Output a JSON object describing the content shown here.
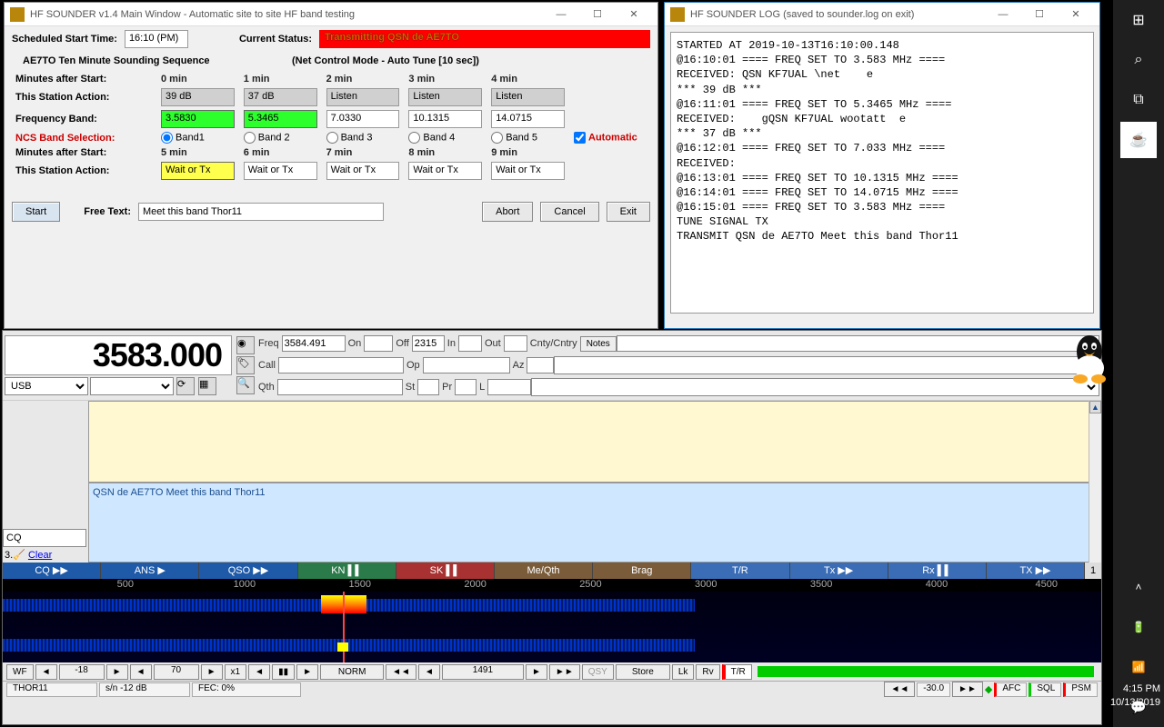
{
  "main": {
    "title": "HF SOUNDER v1.4 Main Window - Automatic site to site HF band testing",
    "sched_lbl": "Scheduled Start Time:",
    "sched_val": "16:10 (PM)",
    "status_lbl": "Current Status:",
    "status_val": "Transmitting QSN de AE7TO",
    "seq_title": "AE7TO  Ten Minute Sounding Sequence",
    "mode_txt": "(Net Control Mode - Auto Tune [10 sec])",
    "min_after": "Minutes after Start:",
    "station_act": "This Station Action:",
    "freq_band": "Frequency Band:",
    "ncs_sel": "NCS Band Selection:",
    "cols1": [
      "0 min",
      "1 min",
      "2 min",
      "3 min",
      "4 min"
    ],
    "acts1": [
      "39 dB",
      "37 dB",
      "Listen",
      "Listen",
      "Listen"
    ],
    "freqs": [
      "3.5830",
      "5.3465",
      "7.0330",
      "10.1315",
      "14.0715"
    ],
    "bands": [
      "Band1",
      "Band 2",
      "Band 3",
      "Band 4",
      "Band 5"
    ],
    "auto": "Automatic",
    "cols2": [
      "5 min",
      "6 min",
      "7 min",
      "8 min",
      "9 min"
    ],
    "acts2": [
      "Wait or Tx",
      "Wait or Tx",
      "Wait or Tx",
      "Wait or Tx",
      "Wait or Tx"
    ],
    "start": "Start",
    "abort": "Abort",
    "cancel": "Cancel",
    "exit": "Exit",
    "freetext_lbl": "Free Text:",
    "freetext_val": "Meet this band Thor11"
  },
  "log": {
    "title": "HF SOUNDER LOG (saved to sounder.log on exit)",
    "text": "STARTED AT 2019-10-13T16:10:00.148\n@16:10:01 ==== FREQ SET TO 3.583 MHz ====\nRECEIVED: QSN KF7UAL \\net    e\n*** 39 dB ***\n@16:11:01 ==== FREQ SET TO 5.3465 MHz ====\nRECEIVED:    gQSN KF7UAL wootatt  e\n*** 37 dB ***\n@16:12:01 ==== FREQ SET TO 7.033 MHz ====\nRECEIVED:\n@16:13:01 ==== FREQ SET TO 10.1315 MHz ====\n@16:14:01 ==== FREQ SET TO 14.0715 MHz ====\n@16:15:01 ==== FREQ SET TO 3.583 MHz ====\nTUNE SIGNAL TX\nTRANSMIT QSN de AE7TO Meet this band Thor11"
  },
  "fldigi": {
    "freq": "3583.000",
    "freq_lbl": "Freq",
    "freq_val": "3584.491",
    "on_lbl": "On",
    "on_val": "",
    "off_lbl": "Off",
    "off_val": "2315",
    "in_lbl": "In",
    "out_lbl": "Out",
    "cnty_lbl": "Cnty/Cntry",
    "notes_lbl": "Notes",
    "call_lbl": "Call",
    "op_lbl": "Op",
    "az_lbl": "Az",
    "qth_lbl": "Qth",
    "st_lbl": "St",
    "pr_lbl": "Pr",
    "l_lbl": "L",
    "mode": "USB",
    "txmsg": "QSN de AE7TO Meet this band Thor11",
    "cq": "CQ",
    "clear": "Clear",
    "clear_pre": "3.",
    "macros": [
      "CQ ▶▶",
      "ANS ▶",
      "QSO ▶▶",
      "KN ▌▌",
      "SK ▌▌",
      "Me/Qth",
      "Brag",
      "T/R",
      "Tx ▶▶",
      "Rx ▌▌",
      "TX ▶▶"
    ],
    "macnum": "1",
    "ruler": [
      "500",
      "1000",
      "1500",
      "2000",
      "2500",
      "3000",
      "3500",
      "4000",
      "4500"
    ],
    "wf": {
      "wf": "WF",
      "v1": "-18",
      "v2": "70",
      "x": "x1",
      "norm": "NORM",
      "center": "1491",
      "qsy": "QSY",
      "store": "Store",
      "lk": "Lk",
      "rv": "Rv",
      "tr": "T/R"
    },
    "status": {
      "mode": "THOR11",
      "sn": "s/n -12 dB",
      "fec": "FEC:    0%",
      "imd": "-30.0",
      "afc": "AFC",
      "sql": "SQL",
      "psm": "PSM"
    }
  },
  "taskbar": {
    "time": "4:15 PM",
    "date": "10/13/2019"
  }
}
